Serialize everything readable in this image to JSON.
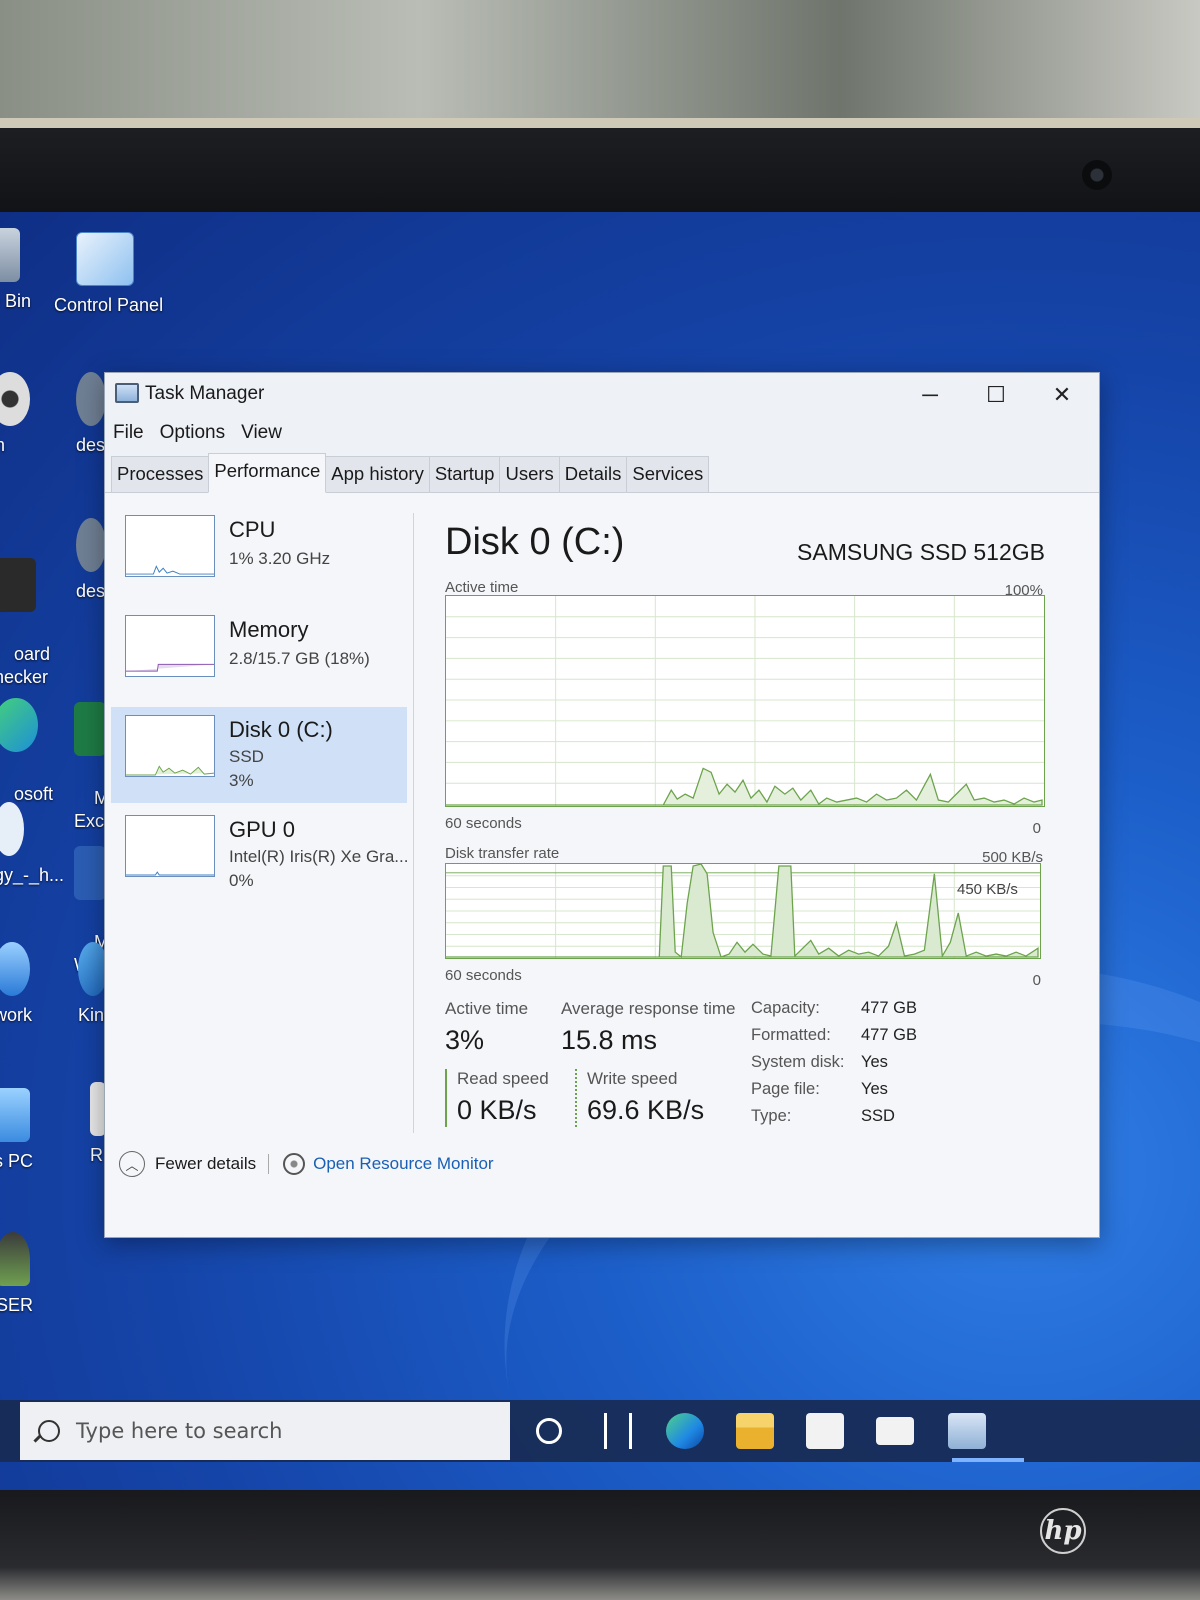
{
  "desktop": {
    "icons": [
      {
        "label": "e Bin"
      },
      {
        "label": "Control Panel"
      },
      {
        "label": "m"
      },
      {
        "label": "des"
      },
      {
        "label": "oard\nhecker"
      },
      {
        "label": "des"
      },
      {
        "label": "osoft\nge"
      },
      {
        "label": "Mic\nExce"
      },
      {
        "label": "gy_-_h..."
      },
      {
        "label": "Mic\nWor"
      },
      {
        "label": "work"
      },
      {
        "label": "King"
      },
      {
        "label": "s PC"
      },
      {
        "label": "R"
      },
      {
        "label": "SER"
      }
    ]
  },
  "window": {
    "title": "Task Manager",
    "menu": [
      "File",
      "Options",
      "View"
    ],
    "tabs": [
      "Processes",
      "Performance",
      "App history",
      "Startup",
      "Users",
      "Details",
      "Services"
    ],
    "active_tab": "Performance"
  },
  "sidebar": {
    "items": [
      {
        "name": "CPU",
        "line1": "1% 3.20 GHz",
        "line2": ""
      },
      {
        "name": "Memory",
        "line1": "2.8/15.7 GB (18%)",
        "line2": ""
      },
      {
        "name": "Disk 0 (C:)",
        "line1": "SSD",
        "line2": "3%"
      },
      {
        "name": "GPU 0",
        "line1": "Intel(R) Iris(R) Xe Gra...",
        "line2": "0%"
      }
    ],
    "selected": "Disk 0 (C:)"
  },
  "detail": {
    "title": "Disk 0 (C:)",
    "model": "SAMSUNG SSD 512GB",
    "graph1": {
      "label": "Active time",
      "max": "100%",
      "time": "60 seconds",
      "min": "0"
    },
    "graph2": {
      "label": "Disk transfer rate",
      "max": "500 KB/s",
      "marker": "450 KB/s",
      "time": "60 seconds",
      "min": "0"
    },
    "stats": {
      "active_time_label": "Active time",
      "active_time_value": "3%",
      "avg_resp_label": "Average response time",
      "avg_resp_value": "15.8 ms",
      "read_label": "Read speed",
      "read_value": "0 KB/s",
      "write_label": "Write speed",
      "write_value": "69.6 KB/s"
    },
    "info": [
      {
        "key": "Capacity:",
        "value": "477 GB"
      },
      {
        "key": "Formatted:",
        "value": "477 GB"
      },
      {
        "key": "System disk:",
        "value": "Yes"
      },
      {
        "key": "Page file:",
        "value": "Yes"
      },
      {
        "key": "Type:",
        "value": "SSD"
      }
    ]
  },
  "footer": {
    "fewer_details": "Fewer details",
    "open_resource_monitor": "Open Resource Monitor"
  },
  "taskbar": {
    "search_placeholder": "Type here to search",
    "icons": [
      "cortana-icon",
      "task-view-icon",
      "edge-icon",
      "file-explorer-icon",
      "store-icon",
      "mail-icon",
      "task-manager-icon"
    ]
  },
  "colors": {
    "graph_line": "#6da34d",
    "selected_bg": "#cfe0f7",
    "link": "#1a5fb4"
  },
  "brand": "hp"
}
